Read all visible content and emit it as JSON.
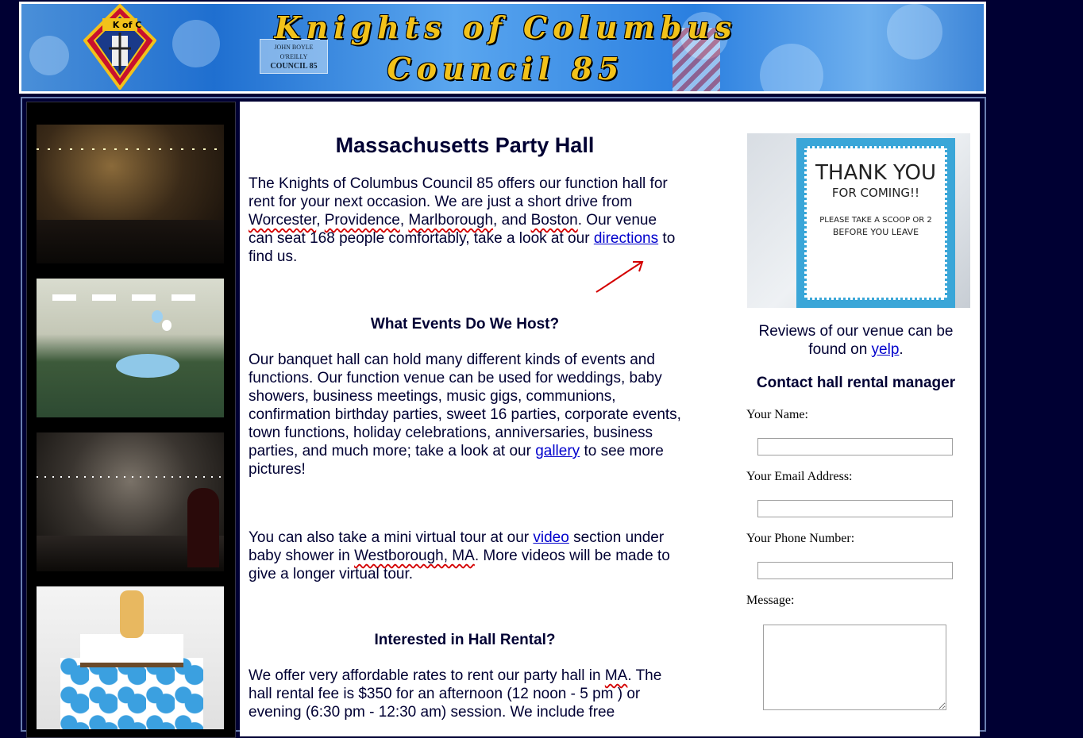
{
  "banner": {
    "title_line1": "Knights of Columbus",
    "title_line2": "Council 85",
    "logo_text": "K of C",
    "sign_line1": "JOHN BOYLE O'REILLY",
    "sign_line2": "COUNCIL 85"
  },
  "main": {
    "title": "Massachusetts Party Hall",
    "intro": {
      "t1": "The Knights of Columbus Council 85 offers our function hall for rent for your next occasion. We are just a short drive from ",
      "city1": "Worcester",
      "sep1": ", ",
      "city2": "Providence",
      "sep2": ", ",
      "city3": "Marlborough",
      "sep3": ", and ",
      "city4": "Boston",
      "t2": ". Our venue can seat 168 people comfortably, take a look at our ",
      "directions_link": "directions",
      "t3": " to find us."
    },
    "events_heading": "What Events Do We Host?",
    "events": {
      "t1": "Our banquet hall can hold many different kinds of events and functions. Our function venue can be used for weddings, baby showers, business meetings, music gigs, communions, confirmation birthday parties, sweet 16 parties, corporate events, town functions, holiday celebrations, anniversaries, business parties, and much more; take a look at our ",
      "gallery_link": "gallery",
      "t2": " to see more pictures!"
    },
    "tour": {
      "t1": "You can also take a mini virtual tour at our ",
      "video_link": "video",
      "t2": " section under baby shower in ",
      "place": "Westborough, MA",
      "t3": ". More videos will be made to give a longer virtual tour."
    },
    "rental_heading": "Interested in Hall Rental?",
    "rental": {
      "t1": "We offer very affordable rates to rent our party hall in ",
      "state": "MA",
      "t2": ". The hall rental fee is $350 for an afternoon (12 noon - 5 pm ) or evening (6:30 pm - 12:30 am) session. We include free"
    }
  },
  "side": {
    "photo_text_line1": "THANK YOU",
    "photo_text_line2": "FOR COMING!!",
    "photo_text_line3": "PLEASE TAKE A SCOOP OR 2",
    "photo_text_line4": "BEFORE YOU LEAVE",
    "reviews_text": "Reviews of our venue can be found on ",
    "yelp_link": "yelp",
    "reviews_end": ".",
    "contact_title": "Contact hall rental manager",
    "form": {
      "name_label": "Your Name:",
      "email_label": "Your Email Address:",
      "phone_label": "Your Phone Number:",
      "message_label": "Message:"
    }
  },
  "colors": {
    "page_bg": "#000033",
    "link": "#0000cc",
    "title_gold": "#f2c21a",
    "annotation_red": "#d40000"
  }
}
